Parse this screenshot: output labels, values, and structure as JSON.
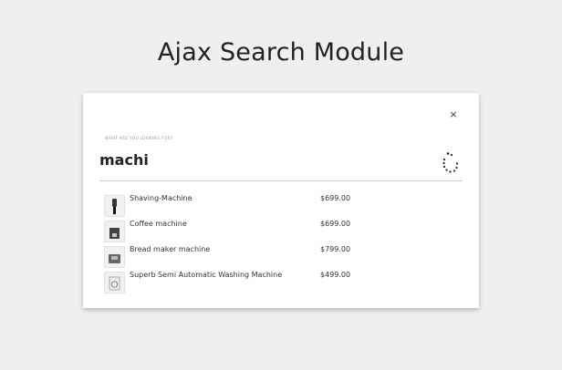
{
  "header": {
    "title": "Ajax Search Module"
  },
  "search": {
    "close_symbol": "×",
    "prompt": "WHAT ARE YOU LOOKING FOR?",
    "query": "machi"
  },
  "results": [
    {
      "name": "Shaving-Machine",
      "price": "$699.00",
      "icon": "shaver-icon"
    },
    {
      "name": "Coffee machine",
      "price": "$699.00",
      "icon": "coffee-machine-icon"
    },
    {
      "name": "Bread maker machine",
      "price": "$799.00",
      "icon": "bread-maker-icon"
    },
    {
      "name": "Superb Semi Automatic Washing Machine",
      "price": "$499.00",
      "icon": "washing-machine-icon"
    }
  ]
}
